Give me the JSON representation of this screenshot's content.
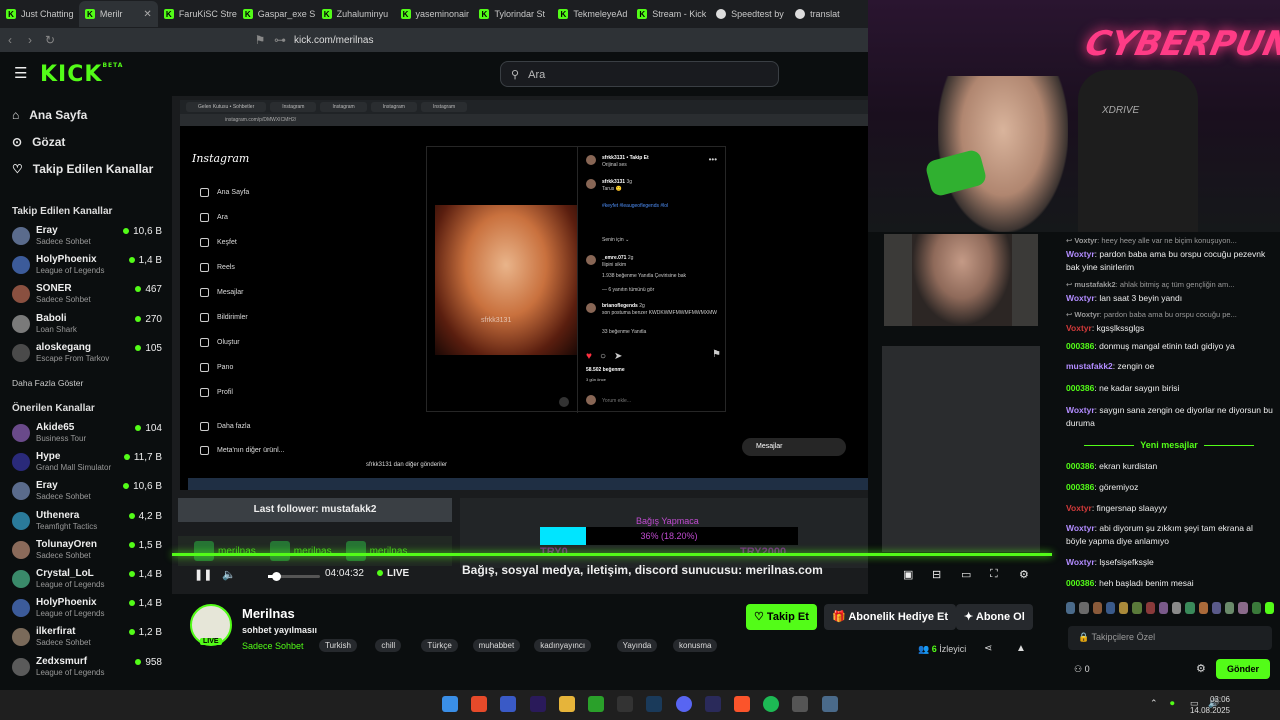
{
  "browser": {
    "tabs": [
      {
        "label": "Just Chatting",
        "active": false
      },
      {
        "label": "Merilr",
        "active": true
      },
      {
        "label": "FaruKiSC Stre",
        "active": false
      },
      {
        "label": "Gaspar_exe S",
        "active": false
      },
      {
        "label": "Zuhaluminyu",
        "active": false
      },
      {
        "label": "yaseminonair",
        "active": false
      },
      {
        "label": "Tylorindar St",
        "active": false
      },
      {
        "label": "TekmeleyeAd",
        "active": false
      },
      {
        "label": "Stream - Kick",
        "active": false
      },
      {
        "label": "Speedtest by",
        "active": false
      },
      {
        "label": "translat",
        "active": false
      }
    ],
    "url": "kick.com/merilnas"
  },
  "header": {
    "logo": "KICK",
    "logo_beta": "BETA",
    "search_placeholder": "Ara"
  },
  "sidebar": {
    "nav": [
      {
        "label": "Ana Sayfa",
        "icon": "home-icon"
      },
      {
        "label": "Gözat",
        "icon": "compass-icon"
      },
      {
        "label": "Takip Edilen Kanallar",
        "icon": "heart-icon"
      }
    ],
    "followed_title": "Takip Edilen Kanallar",
    "followed": [
      {
        "name": "Eray",
        "category": "Sadece Sohbet",
        "viewers": "10,6 B"
      },
      {
        "name": "HolyPhoenix",
        "category": "League of Legends",
        "viewers": "1,4 B"
      },
      {
        "name": "SONER",
        "category": "Sadece Sohbet",
        "viewers": "467"
      },
      {
        "name": "Baboli",
        "category": "Loan Shark",
        "viewers": "270"
      },
      {
        "name": "aloskegang",
        "category": "Escape From Tarkov",
        "viewers": "105"
      }
    ],
    "show_more": "Daha Fazla Göster",
    "recommended_title": "Önerilen Kanallar",
    "recommended": [
      {
        "name": "Akide65",
        "category": "Business Tour",
        "viewers": "104"
      },
      {
        "name": "Hype",
        "category": "Grand Mall Simulator",
        "viewers": "11,7 B"
      },
      {
        "name": "Eray",
        "category": "Sadece Sohbet",
        "viewers": "10,6 B"
      },
      {
        "name": "Uthenera",
        "category": "Teamfight Tactics",
        "viewers": "4,2 B"
      },
      {
        "name": "TolunayOren",
        "category": "Sadece Sohbet",
        "viewers": "1,5 B"
      },
      {
        "name": "Crystal_LoL",
        "category": "League of Legends",
        "viewers": "1,4 B"
      },
      {
        "name": "HolyPhoenix",
        "category": "League of Legends",
        "viewers": "1,4 B"
      },
      {
        "name": "ilkerfirat",
        "category": "Sadece Sohbet",
        "viewers": "1,2 B"
      },
      {
        "name": "Zedxsmurf",
        "category": "League of Legends",
        "viewers": "958"
      }
    ]
  },
  "screen_share": {
    "tabs": [
      "Gelen Kutusu • Sohbetler",
      "Instagram",
      "Instagram",
      "Instagram",
      "Instagram"
    ],
    "url": "instagram.com/p/DMWXICMH2/",
    "ig_logo": "Instagram",
    "ig_nav": [
      "Ana Sayfa",
      "Ara",
      "Keşfet",
      "Reels",
      "Mesajlar",
      "Bildirimler",
      "Oluştur",
      "Pano",
      "Profil"
    ],
    "ig_more": "Daha fazla",
    "ig_meta": "Meta'nın diğer ürünl...",
    "post_user": "sfrkk3131 • Takip Et",
    "post_sub": "Orijinal ses",
    "image_watermark": "sfrkk3131",
    "comments": [
      {
        "user": "sfrkk3131",
        "time": "3g",
        "text": "Tarus 🙂"
      },
      {
        "user": "",
        "time": "",
        "text": "#keyfet #leaugeoflegends #lol"
      },
      {
        "user": "",
        "time": "",
        "text": "Senin için ⌄"
      },
      {
        "user": "_emre.071",
        "time": "2g",
        "text": "Ilipini sikim"
      },
      {
        "user": "",
        "time": "",
        "text": "1.938 beğenme   Yanıtla   Çevirisine bak"
      },
      {
        "user": "",
        "time": "",
        "text": "— 6 yanıtın tümünü gör"
      },
      {
        "user": "brianoflegends",
        "time": "2g",
        "text": "son postuma benzer KWDKWMFMWMFMWMXMW"
      },
      {
        "user": "",
        "time": "",
        "text": "33 beğenme   Yanıtla"
      }
    ],
    "likes": "58.502 beğenme",
    "likes_time": "3 gün önce",
    "comment_placeholder": "Yorum ekle...",
    "more_posts": "sfrkk3131 dan diğer gönderiler",
    "messages_label": "Mesajlar"
  },
  "overlay": {
    "last_follower": "Last follower: mustafakk2",
    "socials": [
      "merilnas",
      "merilnas",
      "merilnas"
    ],
    "donation_label": "Bağış Yapmaca",
    "donation_percent": "36% (18.20%)",
    "donation_fraction": 0.18,
    "donation_min": "TRY0",
    "donation_max": "TRY2000",
    "ticker": "Bağış, sosyal medya, iletişim, discord sunucusu: merilnas.com"
  },
  "player": {
    "time": "04:04:32",
    "live_label": "LIVE",
    "volume_fraction": 0.16
  },
  "stream": {
    "streamer": "Merilnas",
    "live_badge": "LIVE",
    "title": "sohbet yayılmasıı",
    "category": "Sadece Sohbet",
    "tags": [
      "Turkish",
      "chill",
      "Türkçe",
      "muhabbet",
      "kadınyayıncı",
      "Yayında",
      "konusma"
    ],
    "follow_btn": "Takip Et",
    "gift_btn": "Abonelik Hediye Et",
    "sub_btn": "Abone Ol",
    "viewer_count": "6",
    "viewer_label": "İzleyici"
  },
  "webcam": {
    "neon_sign": "CYBERPUNK",
    "chair_brand": "XDRIVE"
  },
  "chat": {
    "messages": [
      {
        "user": "Voxtyr",
        "text": "heey heey alle var ne biçim konuşuyon...",
        "sys": true,
        "color": "#999999"
      },
      {
        "user": "Woxtyr",
        "text": "pardon baba ama bu orspu cocuğu pezevnk bak yine sinirlerim",
        "sys": false,
        "color": "#b28cff"
      },
      {
        "user": "mustafakk2",
        "text": "ahlak bitmiş aç tüm gençliğin am...",
        "sys": true,
        "color": "#999999"
      },
      {
        "user": "Woxtyr",
        "text": "lan saat 3 beyin yandı",
        "sys": false,
        "color": "#b28cff"
      },
      {
        "user": "Woxtyr",
        "text": "pardon baba ama bu orspu cocuğu pe...",
        "sys": true,
        "color": "#999999"
      },
      {
        "user": "Voxtyr",
        "text": "kgsşlkssglgs",
        "sys": false,
        "color": "#d23a3a"
      },
      {
        "user": "000386",
        "text": "donmuş mangal etinin tadı gidiyo ya",
        "sys": false,
        "color": "#53fc18"
      },
      {
        "user": "mustafakk2",
        "text": "zengin oe",
        "sys": false,
        "color": "#b28cff"
      },
      {
        "user": "000386",
        "text": "ne kadar saygın birisi",
        "sys": false,
        "color": "#53fc18"
      },
      {
        "user": "Woxtyr",
        "text": "saygın sana zengin oe diyorlar ne diyorsun bu duruma",
        "sys": false,
        "color": "#b28cff"
      }
    ],
    "new_messages_label": "Yeni mesajlar",
    "new_messages": [
      {
        "user": "000386",
        "text": "ekran kurdistan",
        "color": "#53fc18"
      },
      {
        "user": "000386",
        "text": "göremiyoz",
        "color": "#53fc18"
      },
      {
        "user": "Voxtyr",
        "text": "fingersnap slaayyy",
        "color": "#d23a3a"
      },
      {
        "user": "Woxtyr",
        "text": "abi diyorum şu zıkkım şeyi tam ekrana al böyle yapma diye anlamıyo",
        "color": "#b28cff"
      },
      {
        "user": "Woxtyr",
        "text": "lşsefsişefksşle",
        "color": "#b28cff"
      },
      {
        "user": "000386",
        "text": "heh başladı benim mesai",
        "color": "#53fc18"
      }
    ],
    "input_placeholder": "Takipçilere Özel",
    "points": "0",
    "send_btn": "Gönder"
  },
  "taskbar": {
    "time": "03:06",
    "date": "14.08.2025"
  }
}
